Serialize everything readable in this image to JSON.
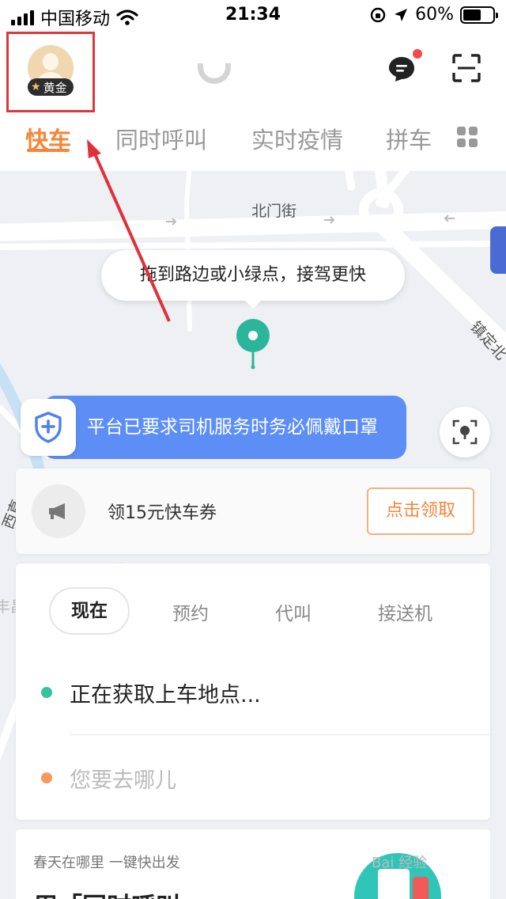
{
  "status_bar": {
    "carrier": "中国移动",
    "time": "21:34",
    "battery_pct": "60%",
    "battery_level": 0.6,
    "icons": [
      "signal-icon",
      "wifi-icon",
      "rotation-lock-icon",
      "location-arrow-icon",
      "battery-icon"
    ]
  },
  "header": {
    "member_badge": "黄金",
    "badge_icon": "star-icon",
    "logo": "didi-logo",
    "message_icon": "message-icon",
    "scan_icon": "scan-icon",
    "tabs": [
      {
        "label": "快车",
        "active": true
      },
      {
        "label": "同时呼叫",
        "active": false
      },
      {
        "label": "实时疫情",
        "active": false
      },
      {
        "label": "拼车",
        "active": false
      }
    ],
    "more_icon": "grid-icon",
    "accent_color": "#f5853a"
  },
  "map": {
    "streets": [
      "北门街",
      "镇定北",
      "西直",
      "丰昌"
    ],
    "tooltip": "拖到路边或小绿点，接驾更快",
    "pin_color": "#2bb59a"
  },
  "mask_notice": {
    "text": "平台已要求司机服务时务必佩戴口罩",
    "color": "#5c8ef5",
    "icon": "shield-plus-icon"
  },
  "coupon": {
    "text": "领15元快车券",
    "button": "点击领取",
    "icon": "megaphone-icon"
  },
  "order": {
    "time_tabs": [
      {
        "label": "现在",
        "active": true
      },
      {
        "label": "预约",
        "active": false
      },
      {
        "label": "代叫",
        "active": false
      },
      {
        "label": "接送机",
        "active": false
      }
    ],
    "pickup": "正在获取上车地点...",
    "destination_placeholder": "您要去哪儿",
    "pickup_color": "#34c39a",
    "destination_color": "#f59a5b"
  },
  "promo": {
    "subtitle": "春天在哪里 一键快出发",
    "title": "用「同时呼叫」"
  },
  "watermark": "Bai 经验"
}
